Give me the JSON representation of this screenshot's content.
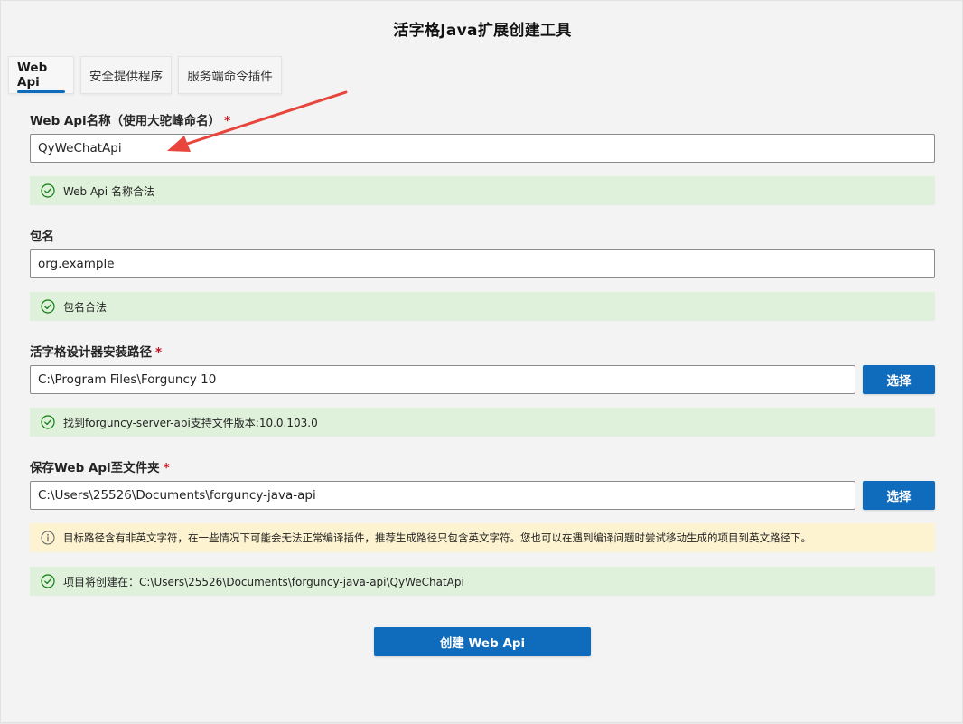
{
  "window": {
    "title": "活字格Java扩展创建工具"
  },
  "tabs": [
    {
      "label": "Web Api",
      "active": true
    },
    {
      "label": "安全提供程序",
      "active": false
    },
    {
      "label": "服务端命令插件",
      "active": false
    }
  ],
  "form": {
    "api_name": {
      "label": "Web Api名称（使用大驼峰命名）",
      "required_mark": "*",
      "value": "QyWeChatApi",
      "validation": "Web Api 名称合法"
    },
    "package": {
      "label": "包名",
      "value": "org.example",
      "validation": "包名合法"
    },
    "install_path": {
      "label": "活字格设计器安装路径",
      "required_mark": "*",
      "value": "C:\\Program Files\\Forguncy 10",
      "browse_label": "选择",
      "validation": "找到forguncy-server-api支持文件版本:10.0.103.0"
    },
    "save_folder": {
      "label": "保存Web Api至文件夹",
      "required_mark": "*",
      "value": "C:\\Users\\25526\\Documents\\forguncy-java-api",
      "browse_label": "选择",
      "warning": "目标路径含有非英文字符，在一些情况下可能会无法正常编译插件，推荐生成路径只包含英文字符。您也可以在遇到编译问题时尝试移动生成的项目到英文路径下。",
      "result": "项目将创建在：C:\\Users\\25526\\Documents\\forguncy-java-api\\QyWeChatApi"
    }
  },
  "create_button": {
    "label": "创建 Web Api"
  },
  "icons": {
    "success": "check-circle-icon",
    "warning": "info-circle-icon"
  },
  "colors": {
    "accent": "#0f6cbd",
    "success_bg": "#dff1da",
    "success_icon": "#107c10",
    "warning_bg": "#fdf3d1",
    "required": "#c50f1f",
    "annotation_arrow": "#e8453c"
  }
}
